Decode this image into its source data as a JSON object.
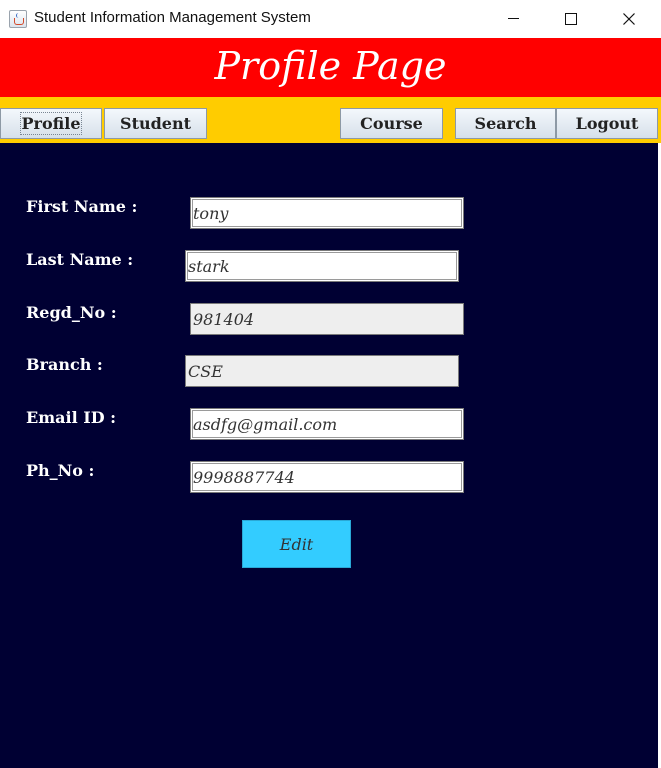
{
  "window": {
    "title": "Student Information Management System"
  },
  "header": {
    "title": "Profile Page",
    "color": "#ff0000"
  },
  "navbar": {
    "color": "#ffcc00",
    "items": [
      {
        "label": "Profile"
      },
      {
        "label": "Student"
      },
      {
        "label": "Course"
      },
      {
        "label": "Search"
      },
      {
        "label": "Logout"
      }
    ]
  },
  "form": {
    "background": "#000033",
    "fields": [
      {
        "label": "First Name :",
        "value": "tony",
        "editable": true
      },
      {
        "label": "Last Name :",
        "value": "stark",
        "editable": true
      },
      {
        "label": "Regd_No :",
        "value": "981404",
        "editable": false
      },
      {
        "label": "Branch :",
        "value": "CSE",
        "editable": false
      },
      {
        "label": "Email ID :",
        "value": "asdfg@gmail.com",
        "editable": true
      },
      {
        "label": "Ph_No :",
        "value": "9998887744",
        "editable": true
      }
    ],
    "edit_button": {
      "label": "Edit",
      "color": "#33ccff"
    }
  }
}
